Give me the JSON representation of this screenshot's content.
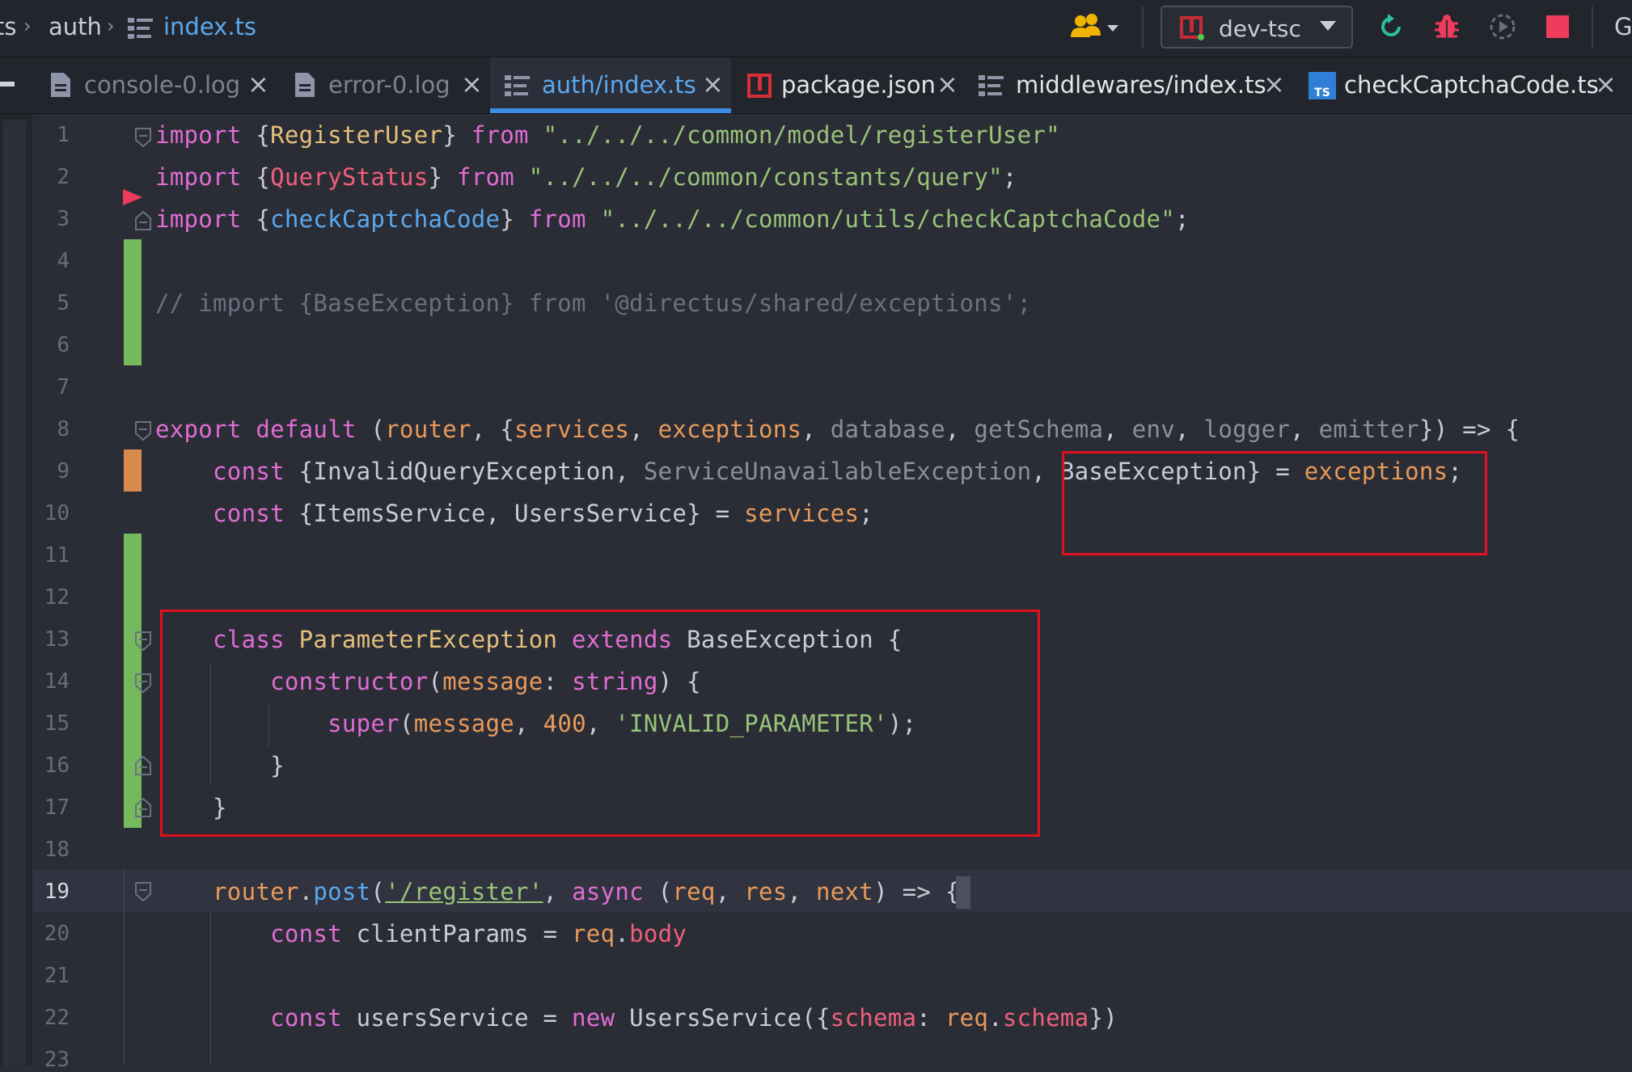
{
  "breadcrumb": {
    "first": "ts",
    "second": "auth",
    "file": "index.ts"
  },
  "toolbar": {
    "run_config": "dev-tsc",
    "right_letter": "G",
    "icons": [
      "users-icon",
      "reload-icon",
      "debug-icon",
      "run-coverage-icon",
      "stop-icon"
    ]
  },
  "tabs": [
    {
      "label": "console-0.log",
      "icon": "file-icon",
      "active": false
    },
    {
      "label": "error-0.log",
      "icon": "file-icon",
      "active": false
    },
    {
      "label": "auth/index.ts",
      "icon": "structure-icon",
      "active": true
    },
    {
      "label": "package.json",
      "icon": "npm-icon",
      "active": false
    },
    {
      "label": "middlewares/index.ts",
      "icon": "structure-icon",
      "active": false
    },
    {
      "label": "checkCaptchaCode.ts",
      "icon": "typescript-icon",
      "active": false
    }
  ],
  "editor": {
    "current_line": 19,
    "line_numbers": [
      "1",
      "2",
      "3",
      "4",
      "5",
      "6",
      "7",
      "8",
      "9",
      "10",
      "11",
      "12",
      "13",
      "14",
      "15",
      "16",
      "17",
      "18",
      "19",
      "20",
      "21",
      "22",
      "23"
    ],
    "lines": [
      [
        [
          "import ",
          "kw"
        ],
        [
          "{",
          "plain"
        ],
        [
          "RegisterUser",
          "cls"
        ],
        [
          "} ",
          "plain"
        ],
        [
          "from ",
          "kw"
        ],
        [
          "\"../../../common/model/registerUser\"",
          "str"
        ]
      ],
      [
        [
          "import ",
          "kw"
        ],
        [
          "{",
          "plain"
        ],
        [
          "QueryStatus",
          "prop"
        ],
        [
          "} ",
          "plain"
        ],
        [
          "from ",
          "kw"
        ],
        [
          "\"../../../common/constants/query\"",
          "str"
        ],
        [
          ";",
          "plain"
        ]
      ],
      [
        [
          "import ",
          "kw"
        ],
        [
          "{",
          "plain"
        ],
        [
          "checkCaptchaCode",
          "fn"
        ],
        [
          "} ",
          "plain"
        ],
        [
          "from ",
          "kw"
        ],
        [
          "\"../../../common/utils/checkCaptchaCode\"",
          "str"
        ],
        [
          ";",
          "plain"
        ]
      ],
      [],
      [
        [
          "// import {BaseException} from '@directus/shared/exceptions';",
          "cm"
        ]
      ],
      [],
      [],
      [
        [
          "export ",
          "kw"
        ],
        [
          "default ",
          "kw"
        ],
        [
          "(",
          "plain"
        ],
        [
          "router",
          "var"
        ],
        [
          ", {",
          "plain"
        ],
        [
          "services",
          "var"
        ],
        [
          ", ",
          "plain"
        ],
        [
          "exceptions",
          "var"
        ],
        [
          ", ",
          "plain"
        ],
        [
          "database",
          "gray"
        ],
        [
          ", ",
          "plain"
        ],
        [
          "getSchema",
          "gray"
        ],
        [
          ", ",
          "plain"
        ],
        [
          "env",
          "gray"
        ],
        [
          ", ",
          "plain"
        ],
        [
          "logger",
          "gray"
        ],
        [
          ", ",
          "plain"
        ],
        [
          "emitter",
          "gray"
        ],
        [
          "}) => {",
          "plain"
        ]
      ],
      [
        [
          "    ",
          "plain"
        ],
        [
          "const ",
          "kw"
        ],
        [
          "{InvalidQueryException, ",
          "plain"
        ],
        [
          "ServiceUnavailableException",
          "gray"
        ],
        [
          ", BaseException} = ",
          "plain"
        ],
        [
          "exceptions",
          "var"
        ],
        [
          ";",
          "plain"
        ]
      ],
      [
        [
          "    ",
          "plain"
        ],
        [
          "const ",
          "kw"
        ],
        [
          "{ItemsService, UsersService} = ",
          "plain"
        ],
        [
          "services",
          "var"
        ],
        [
          ";",
          "plain"
        ]
      ],
      [],
      [],
      [
        [
          "    ",
          "plain"
        ],
        [
          "class ",
          "kw"
        ],
        [
          "ParameterException ",
          "cls"
        ],
        [
          "extends ",
          "kw"
        ],
        [
          "BaseException {",
          "plain"
        ]
      ],
      [
        [
          "        ",
          "plain"
        ],
        [
          "constructor",
          "kw"
        ],
        [
          "(",
          "plain"
        ],
        [
          "message",
          "var"
        ],
        [
          ": ",
          "plain"
        ],
        [
          "string",
          "kw"
        ],
        [
          ") {",
          "plain"
        ]
      ],
      [
        [
          "            ",
          "plain"
        ],
        [
          "super",
          "kw"
        ],
        [
          "(",
          "plain"
        ],
        [
          "message",
          "var"
        ],
        [
          ", ",
          "plain"
        ],
        [
          "400",
          "num"
        ],
        [
          ", ",
          "plain"
        ],
        [
          "'INVALID_PARAMETER'",
          "str"
        ],
        [
          ");",
          "plain"
        ]
      ],
      [
        [
          "        }",
          "plain"
        ]
      ],
      [
        [
          "    }",
          "plain"
        ]
      ],
      [],
      [
        [
          "    ",
          "plain"
        ],
        [
          "router",
          "var"
        ],
        [
          ".",
          "plain"
        ],
        [
          "post",
          "fn"
        ],
        [
          "(",
          "plain"
        ],
        [
          "'/register'",
          "str"
        ],
        [
          ", ",
          "plain"
        ],
        [
          "async ",
          "kw"
        ],
        [
          "(",
          "plain"
        ],
        [
          "req",
          "var"
        ],
        [
          ", ",
          "plain"
        ],
        [
          "res",
          "var"
        ],
        [
          ", ",
          "plain"
        ],
        [
          "next",
          "var"
        ],
        [
          ") => {",
          "plain"
        ]
      ],
      [
        [
          "        ",
          "plain"
        ],
        [
          "const ",
          "kw"
        ],
        [
          "clientParams = ",
          "plain"
        ],
        [
          "req",
          "var"
        ],
        [
          ".",
          "plain"
        ],
        [
          "body",
          "prop"
        ]
      ],
      [],
      [
        [
          "        ",
          "plain"
        ],
        [
          "const ",
          "kw"
        ],
        [
          "usersService = ",
          "plain"
        ],
        [
          "new ",
          "kw"
        ],
        [
          "UsersService({",
          "plain"
        ],
        [
          "schema",
          "prop"
        ],
        [
          ": ",
          "plain"
        ],
        [
          "req",
          "var"
        ],
        [
          ".",
          "plain"
        ],
        [
          "schema",
          "prop"
        ],
        [
          "})",
          "plain"
        ]
      ],
      []
    ]
  }
}
